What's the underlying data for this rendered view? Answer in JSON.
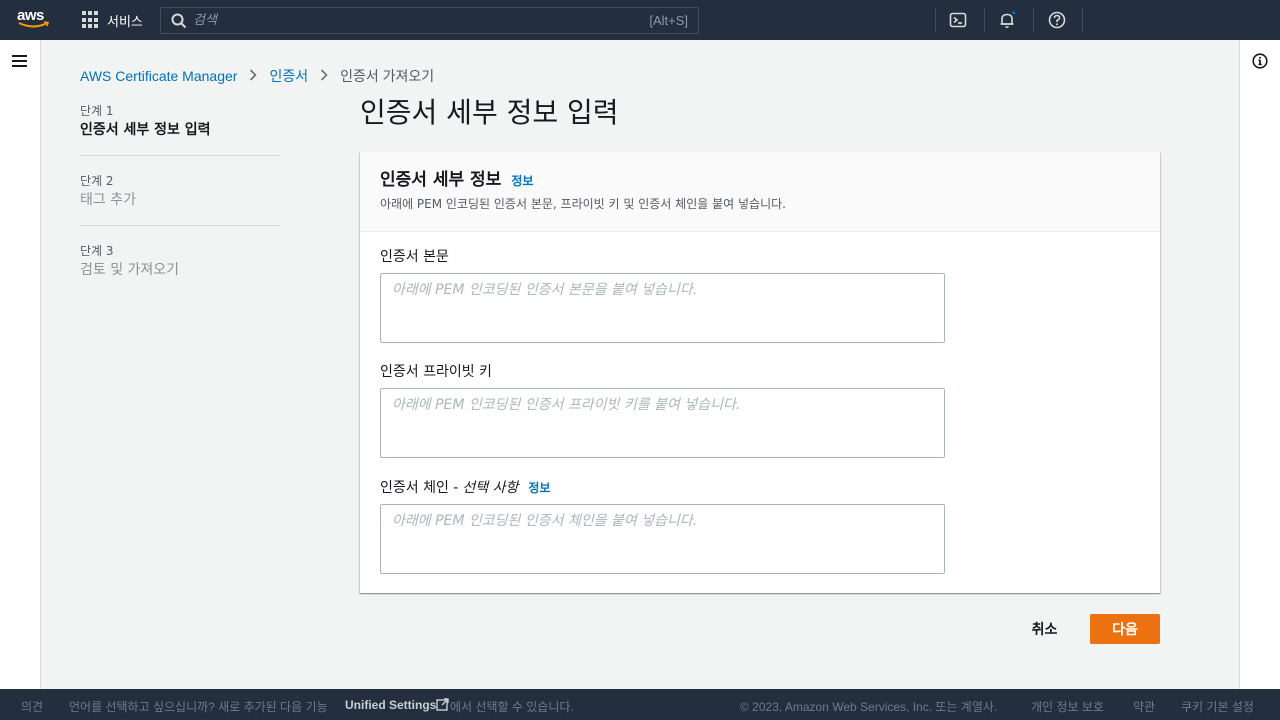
{
  "nav": {
    "logo_text": "aws",
    "services_label": "서비스",
    "search_placeholder": "검색",
    "search_shortcut": "[Alt+S]"
  },
  "breadcrumb": {
    "items": [
      "AWS Certificate Manager",
      "인증서",
      "인증서 가져오기"
    ]
  },
  "steps": [
    {
      "num": "단계 1",
      "title": "인증서 세부 정보 입력",
      "active": true
    },
    {
      "num": "단계 2",
      "title": "태그 추가",
      "active": false
    },
    {
      "num": "단계 3",
      "title": "검토 및 가져오기",
      "active": false
    }
  ],
  "page_title": "인증서 세부 정보 입력",
  "panel": {
    "title": "인증서 세부 정보",
    "info_link": "정보",
    "description": "아래에 PEM 인코딩된 인증서 본문, 프라이빗 키 및 인증서 체인을 붙여 넣습니다.",
    "fields": {
      "body": {
        "label": "인증서 본문",
        "placeholder": "아래에 PEM 인코딩된 인증서 본문을 붙여 넣습니다.",
        "value": ""
      },
      "private_key": {
        "label": "인증서 프라이빗 키",
        "placeholder": "아래에 PEM 인코딩된 인증서 프라이빗 키를 붙여 넣습니다.",
        "value": ""
      },
      "chain": {
        "label": "인증서 체인 -",
        "optional": "선택 사항",
        "info_link": "정보",
        "placeholder": "아래에 PEM 인코딩된 인증서 체인을 붙여 넣습니다.",
        "value": ""
      }
    }
  },
  "buttons": {
    "cancel": "취소",
    "next": "다음"
  },
  "footer": {
    "feedback": "의견",
    "language_prompt": "언어를 선택하고 싶으십니까? 새로 추가된 다음 기능",
    "unified_settings": "Unified Settings",
    "language_suffix": "에서 선택할 수 있습니다.",
    "copyright": "© 2023, Amazon Web Services, Inc. 또는 계열사.",
    "privacy": "개인 정보 보호",
    "terms": "약관",
    "cookies": "쿠키 기본 설정"
  },
  "colors": {
    "nav_bg": "#232f3e",
    "link": "#0073bb",
    "primary_button": "#ec7211",
    "page_bg": "#f2f3f3"
  }
}
